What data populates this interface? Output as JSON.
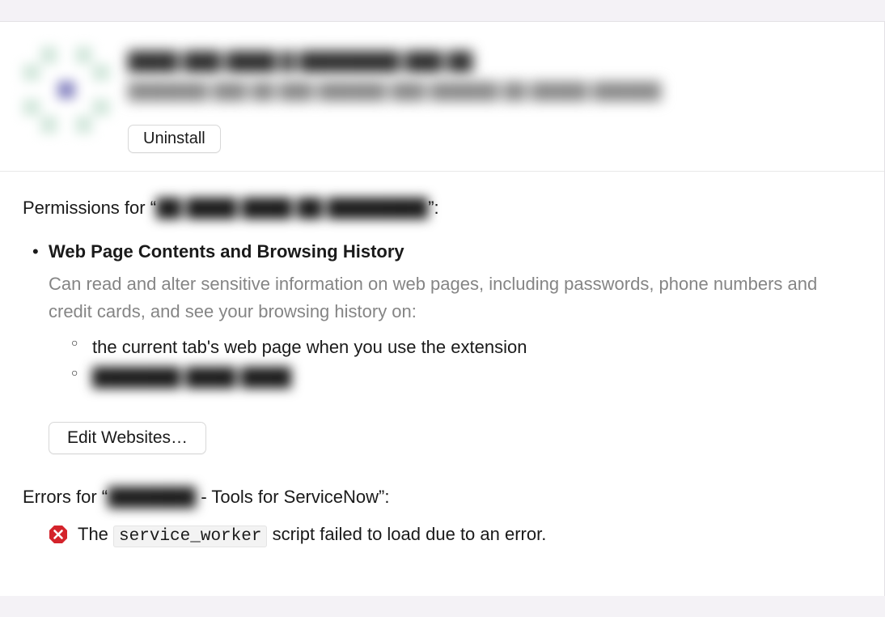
{
  "header": {
    "title_obscured": "████ ███ ████ █ ████████ ███ ██",
    "desc_obscured": "███████ ███ ██ ███ ██████ ███ ██████ ██ █████ ██████",
    "uninstall_label": "Uninstall"
  },
  "permissions": {
    "heading_prefix": "Permissions for “",
    "heading_name_obscured": "██ ████ ████ ██ ████████",
    "heading_suffix": "”:",
    "items": [
      {
        "title": "Web Page Contents and Browsing History",
        "desc": "Can read and alter sensitive information on web pages, including passwords, phone numbers and credit cards, and see your browsing history on:",
        "sub": [
          {
            "text": "the current tab's web page when you use the extension",
            "blurred": false
          },
          {
            "text": "███████ ████ ████",
            "blurred": true
          }
        ]
      }
    ],
    "edit_label": "Edit Websites…"
  },
  "errors": {
    "heading_prefix": "Errors for “",
    "heading_name_obscured": "███████",
    "heading_visible": " - Tools for ServiceNow”:",
    "message_pre": "The ",
    "message_code": "service_worker",
    "message_post": " script failed to load due to an error."
  }
}
